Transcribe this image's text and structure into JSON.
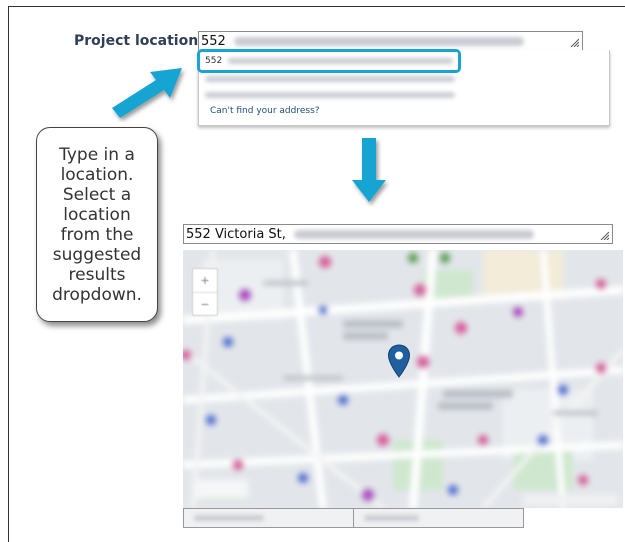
{
  "form": {
    "label": "Project location/s:",
    "search_value": "552",
    "selected_value": "552 Victoria St,"
  },
  "dropdown": {
    "options": [
      {
        "prefix": "552"
      },
      {
        "prefix": ""
      },
      {
        "prefix": ""
      }
    ],
    "cant_find": "Can't find your address?"
  },
  "callout": {
    "text": "Type in a location. Select a location from the suggested results dropdown."
  },
  "colors": {
    "highlight": "#19a4d3",
    "arrow": "#19a4d3",
    "label": "#2f3f55",
    "pin": "#1f5fa0"
  }
}
